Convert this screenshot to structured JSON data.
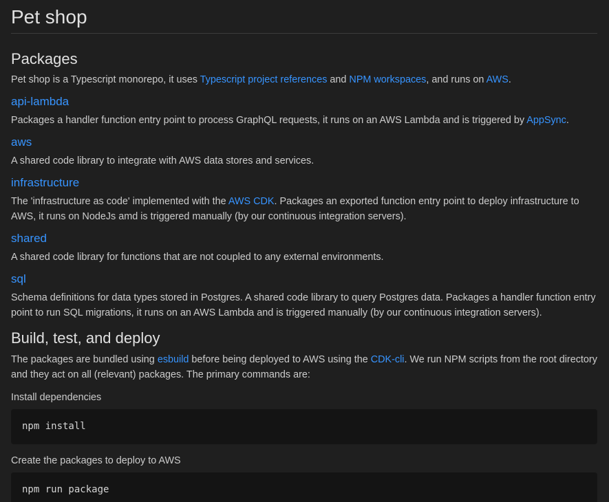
{
  "doc": {
    "title": "Pet shop",
    "packages_heading": "Packages",
    "intro": {
      "t1": "Pet shop is a Typescript monorepo, it uses ",
      "l1": "Typescript project references",
      "t2": " and ",
      "l2": "NPM workspaces",
      "t3": ", and runs on ",
      "l3": "AWS",
      "t4": "."
    },
    "api_lambda": {
      "heading": "api-lambda",
      "t1": "Packages a handler function entry point to process GraphQL requests, it runs on an AWS Lambda and is triggered by ",
      "l1": "AppSync",
      "t2": "."
    },
    "aws": {
      "heading": "aws",
      "text": "A shared code library to integrate with AWS data stores and services."
    },
    "infrastructure": {
      "heading": "infrastructure",
      "t1": "The 'infrastructure as code' implemented with the ",
      "l1": "AWS CDK",
      "t2": ". Packages an exported function entry point to deploy infrastructure to AWS, it runs on NodeJs amd is triggered manually (by our continuous integration servers)."
    },
    "shared": {
      "heading": "shared",
      "text": "A shared code library for functions that are not coupled to any external environments."
    },
    "sql": {
      "heading": "sql",
      "text": "Schema definitions for data types stored in Postgres. A shared code library to query Postgres data. Packages a handler function entry point to run SQL migrations, it runs on an AWS Lambda and is triggered manually (by our continuous integration servers)."
    },
    "build_heading": "Build, test, and deploy",
    "build_intro": {
      "t1": "The packages are bundled using ",
      "l1": "esbuild",
      "t2": " before being deployed to AWS using the ",
      "l2": "CDK-cli",
      "t3": ". We run NPM scripts from the root directory and they act on all (relevant) packages. The primary commands are:"
    },
    "install_label": "Install dependencies",
    "install_cmd": "npm install",
    "package_label": "Create the packages to deploy to AWS",
    "package_cmd": "npm run package"
  }
}
